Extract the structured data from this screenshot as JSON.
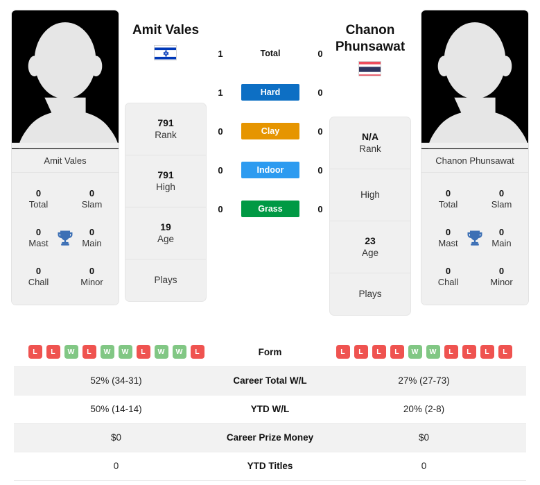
{
  "players": {
    "left": {
      "name": "Amit Vales",
      "card_name": "Amit Vales",
      "country": "israel",
      "rank": "791",
      "rank_label": "Rank",
      "high": "791",
      "high_label": "High",
      "age": "19",
      "age_label": "Age",
      "plays_label": "Plays",
      "plays_value": "",
      "titles": {
        "total": "0",
        "total_label": "Total",
        "slam": "0",
        "slam_label": "Slam",
        "mast": "0",
        "mast_label": "Mast",
        "main": "0",
        "main_label": "Main",
        "chall": "0",
        "chall_label": "Chall",
        "minor": "0",
        "minor_label": "Minor"
      },
      "form": [
        "L",
        "L",
        "W",
        "L",
        "W",
        "W",
        "L",
        "W",
        "W",
        "L"
      ],
      "career_total_wl": "52% (34-31)",
      "ytd_wl": "50% (14-14)",
      "career_prize_money": "$0",
      "ytd_titles": "0"
    },
    "right": {
      "name": "Chanon Phunsawat",
      "name_line1": "Chanon",
      "name_line2": "Phunsawat",
      "card_name": "Chanon Phunsawat",
      "country": "thailand",
      "rank": "N/A",
      "rank_label": "Rank",
      "high": "",
      "high_label": "High",
      "age": "23",
      "age_label": "Age",
      "plays_label": "Plays",
      "plays_value": "",
      "titles": {
        "total": "0",
        "total_label": "Total",
        "slam": "0",
        "slam_label": "Slam",
        "mast": "0",
        "mast_label": "Mast",
        "main": "0",
        "main_label": "Main",
        "chall": "0",
        "chall_label": "Chall",
        "minor": "0",
        "minor_label": "Minor"
      },
      "form": [
        "L",
        "L",
        "L",
        "L",
        "W",
        "W",
        "L",
        "L",
        "L",
        "L"
      ],
      "career_total_wl": "27% (27-73)",
      "ytd_wl": "20% (2-8)",
      "career_prize_money": "$0",
      "ytd_titles": "0"
    }
  },
  "head_to_head": {
    "rows": [
      {
        "label": "Total",
        "left": "1",
        "right": "0",
        "chip": false,
        "color": "#111111"
      },
      {
        "label": "Hard",
        "left": "1",
        "right": "0",
        "chip": true,
        "color": "#0d6fc4"
      },
      {
        "label": "Clay",
        "left": "0",
        "right": "0",
        "chip": true,
        "color": "#e69500"
      },
      {
        "label": "Indoor",
        "left": "0",
        "right": "0",
        "chip": true,
        "color": "#2d9bf0"
      },
      {
        "label": "Grass",
        "left": "0",
        "right": "0",
        "chip": true,
        "color": "#009944"
      }
    ]
  },
  "comparison_table": {
    "rows": [
      {
        "label": "Form",
        "type": "form"
      },
      {
        "label": "Career Total W/L",
        "type": "text",
        "key": "career_total_wl"
      },
      {
        "label": "YTD W/L",
        "type": "text",
        "key": "ytd_wl"
      },
      {
        "label": "Career Prize Money",
        "type": "text",
        "key": "career_prize_money"
      },
      {
        "label": "YTD Titles",
        "type": "text",
        "key": "ytd_titles"
      }
    ]
  },
  "theme": {
    "win_color": "#81c784",
    "loss_color": "#ef5350",
    "trophy_color": "#3b6fb5",
    "card_bg": "#f0f0f0",
    "alt_row_bg": "#f2f2f2"
  }
}
